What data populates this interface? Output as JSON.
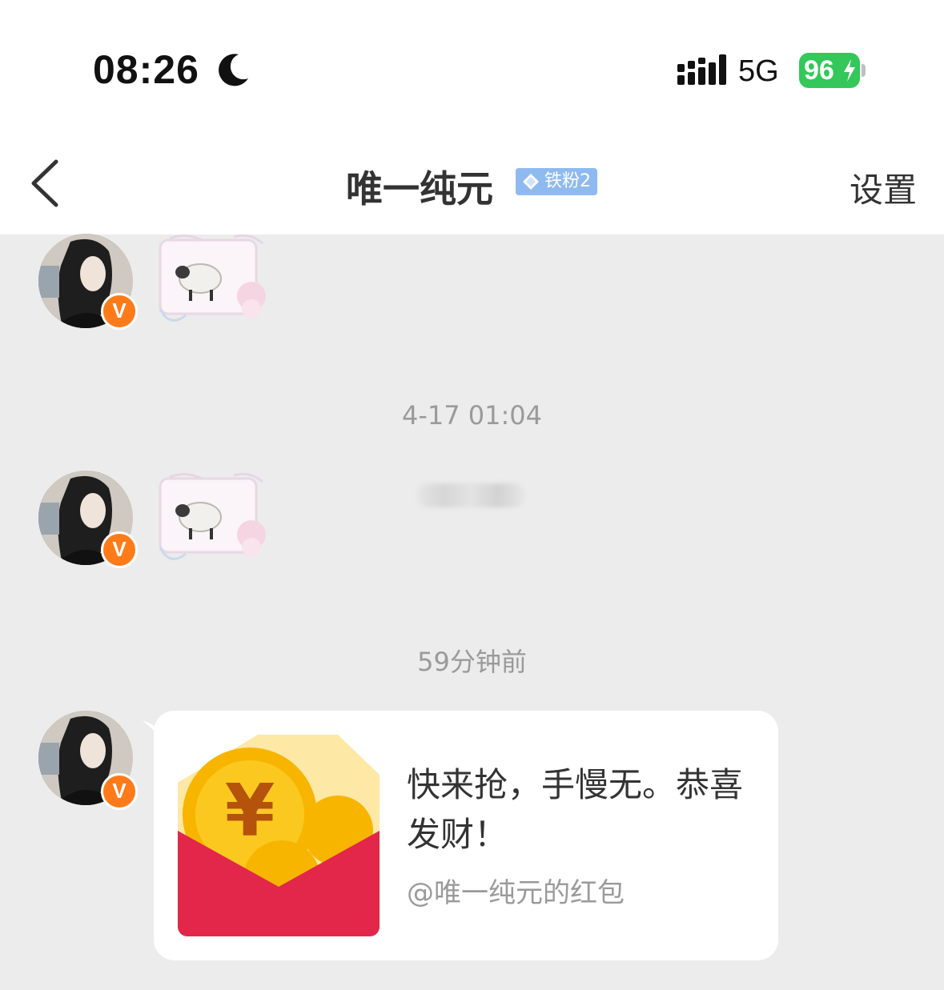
{
  "status_bar": {
    "time": "08:26",
    "network": "5G",
    "battery": "96"
  },
  "header": {
    "title": "唯一纯元",
    "fan_badge": "铁粉2",
    "settings_label": "设置"
  },
  "messages": [
    {
      "type": "sticker",
      "sender_badge": "V",
      "sticker_icon": "sheep-sticker"
    },
    {
      "type": "timestamp",
      "text": "4-17 01:04"
    },
    {
      "type": "sticker",
      "sender_badge": "V",
      "sticker_icon": "sheep-sticker"
    },
    {
      "type": "timestamp",
      "text": "59分钟前"
    },
    {
      "type": "red_packet",
      "sender_badge": "V",
      "message": "快来抢，手慢无。恭喜发财！",
      "from": "@唯一纯元的红包"
    }
  ],
  "colors": {
    "background": "#ececec",
    "vip_badge": "#ff7b1a",
    "fan_badge": "#8fbaf0",
    "battery": "#34c759",
    "packet_red": "#e2274a",
    "coin_gold": "#f7b500"
  }
}
